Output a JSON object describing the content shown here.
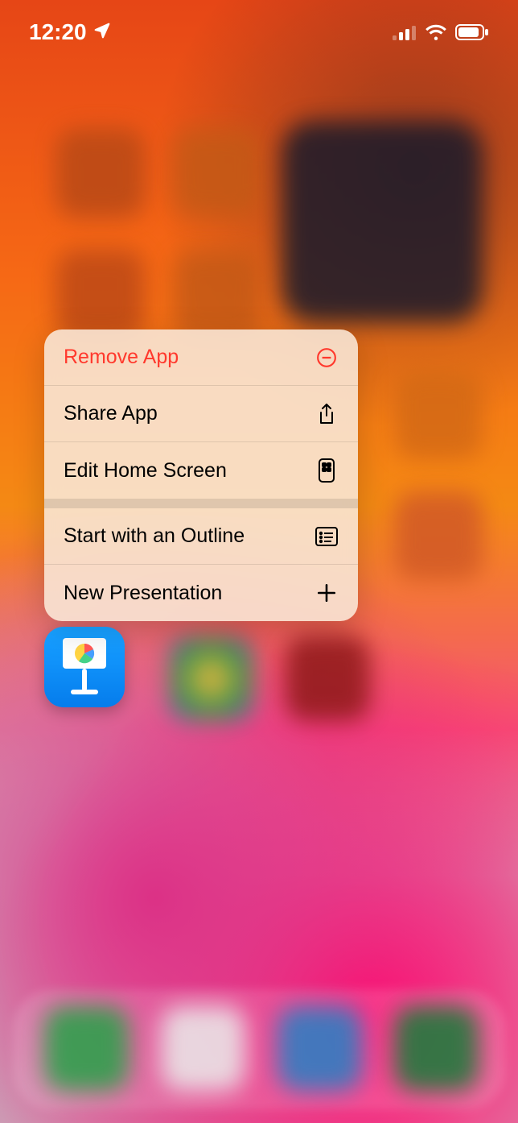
{
  "status_bar": {
    "time": "12:20"
  },
  "menu": {
    "remove_app": "Remove App",
    "share_app": "Share App",
    "edit_home_screen": "Edit Home Screen",
    "start_outline": "Start with an Outline",
    "new_presentation": "New Presentation"
  },
  "app": {
    "name": "Keynote"
  },
  "colors": {
    "destructive": "#ff3b30",
    "app_icon_top": "#1ea3ff",
    "app_icon_bottom": "#0a7be6"
  }
}
